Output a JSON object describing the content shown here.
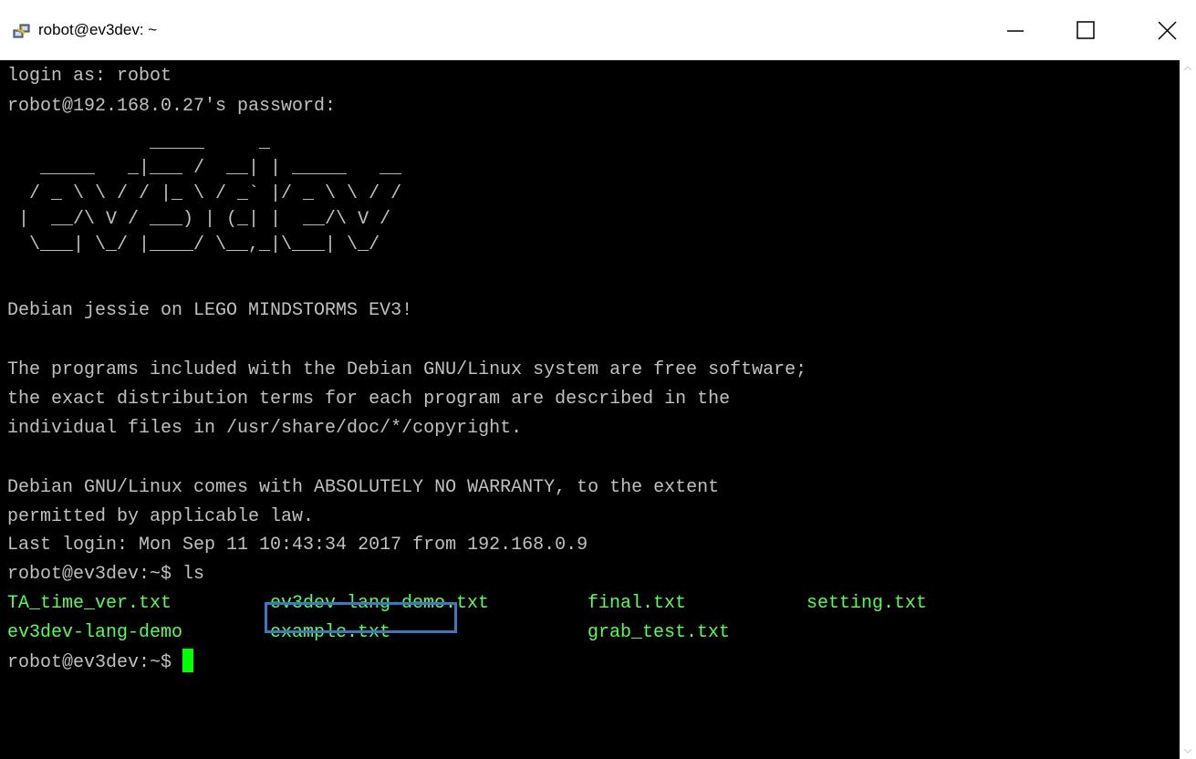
{
  "window": {
    "title": "robot@ev3dev: ~",
    "icons": {
      "app": "putty-icon",
      "minimize": "minimize-icon",
      "maximize": "maximize-icon",
      "close": "close-icon"
    }
  },
  "terminal": {
    "login_line": "login as: robot",
    "password_line": "robot@192.168.0.27's password:",
    "ascii_art": [
      "             _____     _",
      "   _____   _|___ /  __| | _____   __",
      "  / _ \\ \\ / / |_ \\ / _` |/ _ \\ \\ / /",
      " |  __/\\ V / ___) | (_| |  __/\\ V /",
      "  \\___| \\_/ |____/ \\__,_|\\___| \\_/"
    ],
    "banner": "Debian jessie on LEGO MINDSTORMS EV3!",
    "license_1": "The programs included with the Debian GNU/Linux system are free software;",
    "license_2": "the exact distribution terms for each program are described in the",
    "license_3": "individual files in /usr/share/doc/*/copyright.",
    "warranty_1": "Debian GNU/Linux comes with ABSOLUTELY NO WARRANTY, to the extent",
    "warranty_2": "permitted by applicable law.",
    "last_login": "Last login: Mon Sep 11 10:43:34 2017 from 192.168.0.9",
    "command_line": "robot@ev3dev:~$ ls",
    "ls_row_1": [
      "TA_time_ver.txt",
      "ev3dev-lang-demo.txt",
      "final.txt",
      "setting.txt"
    ],
    "ls_row_2": [
      "ev3dev-lang-demo",
      "example.txt",
      "grab_test.txt"
    ],
    "prompt": "robot@ev3dev:~$ ",
    "highlighted_file": "example.txt"
  },
  "colors": {
    "terminal_bg": "#000000",
    "text": "#c0c0c0",
    "file_green": "#55ff55",
    "cursor": "#00ff00",
    "highlight_border": "#3a78c6"
  }
}
